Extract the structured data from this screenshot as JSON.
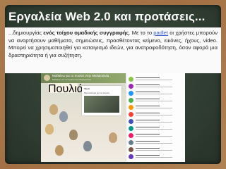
{
  "slide": {
    "title": "Εργαλεία Web 2.0 και προτάσεις...",
    "body": {
      "part1": "...δημιουργίας ",
      "bold": "ενός τοίχου ομαδικής συγγραφής",
      "part2": ". Με το το ",
      "link": "padlet",
      "part3": " οι χρήστες μπορούν να αναρτήσουν μαθήματα, σημειώσεις, προσθέτοντας κείμενο, εικόνες, ήχους, video. Μπορεί να χρησιμοποιηθεί για καταιγισμό ιδεών, για ανατροφοδότηση, όσον αφορά μια δραστηριότητα ή για συζήτηση."
    }
  },
  "padlet": {
    "header_title": "Μαθαίνω για τα πουλιά στην Μαλαισιανία",
    "header_sub": "Μαθαίνω για τα πουλιά στην Μαλαισιανία",
    "pill_text": "Πουλιά",
    "card_title": "Ψηλά",
    "card_text": "Περισσότερα για τα πουλιά",
    "colors": [
      "#8bc34a",
      "#9c27b0",
      "#2196f3",
      "#4caf50",
      "#ff9800",
      "#f44336",
      "#3f51b5",
      "#009688",
      "#e91e63",
      "#607d8b",
      "#795548",
      "#673ab7"
    ]
  }
}
